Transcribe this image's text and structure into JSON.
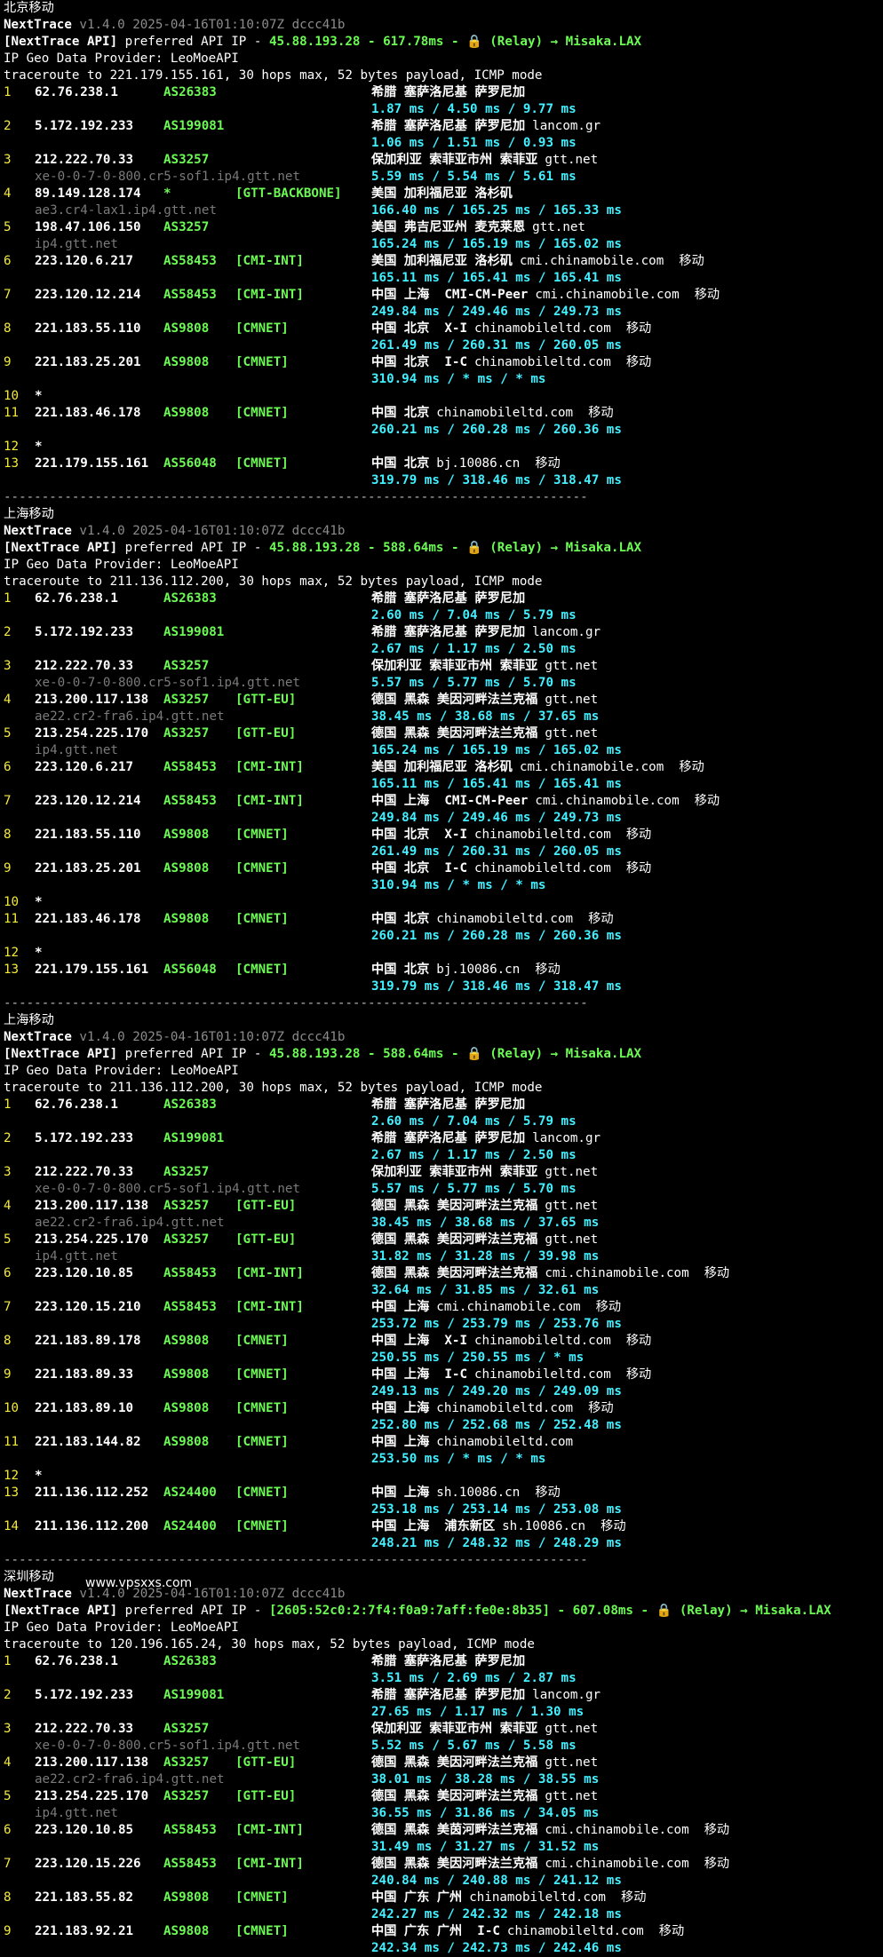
{
  "watermark": "www.vpsxxs.com",
  "sections": [
    {
      "loc": "北京移动",
      "ver_name": "NextTrace",
      "ver": "v1.4.0 2025-04-16T01:10:07Z dccc41b",
      "api_prefix": "[NextTrace API]",
      "api_text": " preferred API IP - ",
      "api_ip": "45.88.193.28",
      "api_dash": " - ",
      "api_ms": "617.78ms",
      "api_relay": " - 🔒 (Relay) → Misaka.LAX",
      "geo_provider": "IP Geo Data Provider: LeoMoeAPI",
      "trace": "traceroute to 221.179.155.161, 30 hops max, 52 bytes payload, ICMP mode",
      "hops": [
        {
          "n": "1",
          "ip": "62.76.238.1",
          "as": "AS26383",
          "tag": "",
          "geo": "希腊 塞萨洛尼基 萨罗尼加",
          "isp": "",
          "dom": "",
          "rtt": "1.87 ms / 4.50 ms / 9.77 ms"
        },
        {
          "n": "2",
          "ip": "5.172.192.233",
          "as": "AS199081",
          "tag": "",
          "geo": "希腊 塞萨洛尼基 萨罗尼加",
          "isp": "lancom.gr",
          "dom": "",
          "rtt": "1.06 ms / 1.51 ms / 0.93 ms"
        },
        {
          "n": "3",
          "ip": "212.222.70.33",
          "as": "AS3257",
          "tag": "",
          "geo": "保加利亚 索菲亚市州 索菲亚",
          "isp": "gtt.net",
          "dom": "xe-0-0-7-0-800.cr5-sof1.ip4.gtt.net",
          "rtt": "5.59 ms / 5.54 ms / 5.61 ms"
        },
        {
          "n": "4",
          "ip": "89.149.128.174",
          "as": "*",
          "tag": "[GTT-BACKBONE]",
          "geo": "美国 加利福尼亚 洛杉矶",
          "isp": "",
          "dom": "ae3.cr4-lax1.ip4.gtt.net",
          "rtt": "166.40 ms / 165.25 ms / 165.33 ms"
        },
        {
          "n": "5",
          "ip": "198.47.106.150",
          "as": "AS3257",
          "tag": "",
          "geo": "美国 弗吉尼亚州 麦克莱恩",
          "isp": "gtt.net",
          "dom": "ip4.gtt.net",
          "rtt": "165.24 ms / 165.19 ms / 165.02 ms"
        },
        {
          "n": "6",
          "ip": "223.120.6.217",
          "as": "AS58453",
          "tag": "[CMI-INT]",
          "geo": "美国 加利福尼亚 洛杉矶",
          "isp": "cmi.chinamobile.com  移动",
          "dom": "",
          "rtt": "165.11 ms / 165.41 ms / 165.41 ms"
        },
        {
          "n": "7",
          "ip": "223.120.12.214",
          "as": "AS58453",
          "tag": "[CMI-INT]",
          "geo": "中国 上海  CMI-CM-Peer",
          "isp": "cmi.chinamobile.com  移动",
          "dom": "",
          "rtt": "249.84 ms / 249.46 ms / 249.73 ms"
        },
        {
          "n": "8",
          "ip": "221.183.55.110",
          "as": "AS9808",
          "tag": "[CMNET]",
          "geo": "中国 北京  X-I",
          "isp": "chinamobileltd.com  移动",
          "dom": "",
          "rtt": "261.49 ms / 260.31 ms / 260.05 ms"
        },
        {
          "n": "9",
          "ip": "221.183.25.201",
          "as": "AS9808",
          "tag": "[CMNET]",
          "geo": "中国 北京  I-C",
          "isp": "chinamobileltd.com  移动",
          "dom": "",
          "rtt": "310.94 ms / * ms / * ms"
        },
        {
          "n": "10",
          "ip": "*",
          "as": "",
          "tag": "",
          "geo": "",
          "isp": "",
          "dom": "",
          "rtt": ""
        },
        {
          "n": "11",
          "ip": "221.183.46.178",
          "as": "AS9808",
          "tag": "[CMNET]",
          "geo": "中国 北京",
          "isp": "chinamobileltd.com  移动",
          "dom": "",
          "rtt": "260.21 ms / 260.28 ms / 260.36 ms"
        },
        {
          "n": "12",
          "ip": "*",
          "as": "",
          "tag": "",
          "geo": "",
          "isp": "",
          "dom": "",
          "rtt": ""
        },
        {
          "n": "13",
          "ip": "221.179.155.161",
          "as": "AS56048",
          "tag": "[CMNET]",
          "geo": "中国 北京",
          "isp": "bj.10086.cn  移动",
          "dom": "",
          "rtt": "319.79 ms / 318.46 ms / 318.47 ms"
        }
      ]
    },
    {
      "loc": "上海移动",
      "ver_name": "NextTrace",
      "ver": "v1.4.0 2025-04-16T01:10:07Z dccc41b",
      "api_prefix": "[NextTrace API]",
      "api_text": " preferred API IP - ",
      "api_ip": "45.88.193.28",
      "api_dash": " - ",
      "api_ms": "588.64ms",
      "api_relay": " - 🔒 (Relay) → Misaka.LAX",
      "geo_provider": "IP Geo Data Provider: LeoMoeAPI",
      "trace": "traceroute to 211.136.112.200, 30 hops max, 52 bytes payload, ICMP mode",
      "hops": [
        {
          "n": "1",
          "ip": "62.76.238.1",
          "as": "AS26383",
          "tag": "",
          "geo": "希腊 塞萨洛尼基 萨罗尼加",
          "isp": "",
          "dom": "",
          "rtt": "2.60 ms / 7.04 ms / 5.79 ms"
        },
        {
          "n": "2",
          "ip": "5.172.192.233",
          "as": "AS199081",
          "tag": "",
          "geo": "希腊 塞萨洛尼基 萨罗尼加",
          "isp": "lancom.gr",
          "dom": "",
          "rtt": "2.67 ms / 1.17 ms / 2.50 ms"
        },
        {
          "n": "3",
          "ip": "212.222.70.33",
          "as": "AS3257",
          "tag": "",
          "geo": "保加利亚 索菲亚市州 索菲亚",
          "isp": "gtt.net",
          "dom": "xe-0-0-7-0-800.cr5-sof1.ip4.gtt.net",
          "rtt": "5.57 ms / 5.77 ms / 5.70 ms"
        },
        {
          "n": "4",
          "ip": "213.200.117.138",
          "as": "AS3257",
          "tag": "[GTT-EU]",
          "geo": "德国 黑森 美因河畔法兰克福",
          "isp": "gtt.net",
          "dom": "ae22.cr2-fra6.ip4.gtt.net",
          "rtt": "38.45 ms / 38.68 ms / 37.65 ms"
        },
        {
          "n": "5",
          "ip": "213.254.225.170",
          "as": "AS3257",
          "tag": "[GTT-EU]",
          "geo": "德国 黑森 美因河畔法兰克福",
          "isp": "gtt.net",
          "dom": "ip4.gtt.net",
          "rtt": "165.24 ms / 165.19 ms / 165.02 ms"
        },
        {
          "n": "6",
          "ip": "223.120.6.217",
          "as": "AS58453",
          "tag": "[CMI-INT]",
          "geo": "美国 加利福尼亚 洛杉矶",
          "isp": "cmi.chinamobile.com  移动",
          "dom": "",
          "rtt": "165.11 ms / 165.41 ms / 165.41 ms"
        },
        {
          "n": "7",
          "ip": "223.120.12.214",
          "as": "AS58453",
          "tag": "[CMI-INT]",
          "geo": "中国 上海  CMI-CM-Peer",
          "isp": "cmi.chinamobile.com  移动",
          "dom": "",
          "rtt": "249.84 ms / 249.46 ms / 249.73 ms"
        },
        {
          "n": "8",
          "ip": "221.183.55.110",
          "as": "AS9808",
          "tag": "[CMNET]",
          "geo": "中国 北京  X-I",
          "isp": "chinamobileltd.com  移动",
          "dom": "",
          "rtt": "261.49 ms / 260.31 ms / 260.05 ms"
        },
        {
          "n": "9",
          "ip": "221.183.25.201",
          "as": "AS9808",
          "tag": "[CMNET]",
          "geo": "中国 北京  I-C",
          "isp": "chinamobileltd.com  移动",
          "dom": "",
          "rtt": "310.94 ms / * ms / * ms"
        },
        {
          "n": "10",
          "ip": "*",
          "as": "",
          "tag": "",
          "geo": "",
          "isp": "",
          "dom": "",
          "rtt": ""
        },
        {
          "n": "11",
          "ip": "221.183.46.178",
          "as": "AS9808",
          "tag": "[CMNET]",
          "geo": "中国 北京",
          "isp": "chinamobileltd.com  移动",
          "dom": "",
          "rtt": "260.21 ms / 260.28 ms / 260.36 ms"
        },
        {
          "n": "12",
          "ip": "*",
          "as": "",
          "tag": "",
          "geo": "",
          "isp": "",
          "dom": "",
          "rtt": ""
        },
        {
          "n": "13",
          "ip": "221.179.155.161",
          "as": "AS56048",
          "tag": "[CMNET]",
          "geo": "中国 北京",
          "isp": "bj.10086.cn  移动",
          "dom": "",
          "rtt": "319.79 ms / 318.46 ms / 318.47 ms"
        }
      ]
    },
    {
      "loc": "上海移动",
      "ver_name": "NextTrace",
      "ver": "v1.4.0 2025-04-16T01:10:07Z dccc41b",
      "api_prefix": "[NextTrace API]",
      "api_text": " preferred API IP - ",
      "api_ip": "45.88.193.28",
      "api_dash": " - ",
      "api_ms": "588.64ms",
      "api_relay": " - 🔒 (Relay) → Misaka.LAX",
      "geo_provider": "IP Geo Data Provider: LeoMoeAPI",
      "trace": "traceroute to 211.136.112.200, 30 hops max, 52 bytes payload, ICMP mode",
      "hops": [
        {
          "n": "1",
          "ip": "62.76.238.1",
          "as": "AS26383",
          "tag": "",
          "geo": "希腊 塞萨洛尼基 萨罗尼加",
          "isp": "",
          "dom": "",
          "rtt": "2.60 ms / 7.04 ms / 5.79 ms"
        },
        {
          "n": "2",
          "ip": "5.172.192.233",
          "as": "AS199081",
          "tag": "",
          "geo": "希腊 塞萨洛尼基 萨罗尼加",
          "isp": "lancom.gr",
          "dom": "",
          "rtt": "2.67 ms / 1.17 ms / 2.50 ms"
        },
        {
          "n": "3",
          "ip": "212.222.70.33",
          "as": "AS3257",
          "tag": "",
          "geo": "保加利亚 索菲亚市州 索菲亚",
          "isp": "gtt.net",
          "dom": "xe-0-0-7-0-800.cr5-sof1.ip4.gtt.net",
          "rtt": "5.57 ms / 5.77 ms / 5.70 ms"
        },
        {
          "n": "4",
          "ip": "213.200.117.138",
          "as": "AS3257",
          "tag": "[GTT-EU]",
          "geo": "德国 黑森 美因河畔法兰克福",
          "isp": "gtt.net",
          "dom": "ae22.cr2-fra6.ip4.gtt.net",
          "rtt": "38.45 ms / 38.68 ms / 37.65 ms"
        },
        {
          "n": "5",
          "ip": "213.254.225.170",
          "as": "AS3257",
          "tag": "[GTT-EU]",
          "geo": "德国 黑森 美因河畔法兰克福",
          "isp": "gtt.net",
          "dom": "ip4.gtt.net",
          "rtt": "31.82 ms / 31.28 ms / 39.98 ms"
        },
        {
          "n": "6",
          "ip": "223.120.10.85",
          "as": "AS58453",
          "tag": "[CMI-INT]",
          "geo": "德国 黑森 美因河畔法兰克福",
          "isp": "cmi.chinamobile.com  移动",
          "dom": "",
          "rtt": "32.64 ms / 31.85 ms / 32.61 ms"
        },
        {
          "n": "7",
          "ip": "223.120.15.210",
          "as": "AS58453",
          "tag": "[CMI-INT]",
          "geo": "中国 上海",
          "isp": "cmi.chinamobile.com  移动",
          "dom": "",
          "rtt": "253.72 ms / 253.79 ms / 253.76 ms"
        },
        {
          "n": "8",
          "ip": "221.183.89.178",
          "as": "AS9808",
          "tag": "[CMNET]",
          "geo": "中国 上海  X-I",
          "isp": "chinamobileltd.com  移动",
          "dom": "",
          "rtt": "250.55 ms / 250.55 ms / * ms"
        },
        {
          "n": "9",
          "ip": "221.183.89.33",
          "as": "AS9808",
          "tag": "[CMNET]",
          "geo": "中国 上海  I-C",
          "isp": "chinamobileltd.com  移动",
          "dom": "",
          "rtt": "249.13 ms / 249.20 ms / 249.09 ms"
        },
        {
          "n": "10",
          "ip": "221.183.89.10",
          "as": "AS9808",
          "tag": "[CMNET]",
          "geo": "中国 上海",
          "isp": "chinamobileltd.com  移动",
          "dom": "",
          "rtt": "252.80 ms / 252.68 ms / 252.48 ms"
        },
        {
          "n": "11",
          "ip": "221.183.144.82",
          "as": "AS9808",
          "tag": "[CMNET]",
          "geo": "中国 上海",
          "isp": "chinamobileltd.com",
          "dom": "",
          "rtt": "253.50 ms / * ms / * ms"
        },
        {
          "n": "12",
          "ip": "*",
          "as": "",
          "tag": "",
          "geo": "",
          "isp": "",
          "dom": "",
          "rtt": ""
        },
        {
          "n": "13",
          "ip": "211.136.112.252",
          "as": "AS24400",
          "tag": "[CMNET]",
          "geo": "中国 上海",
          "isp": "sh.10086.cn  移动",
          "dom": "",
          "rtt": "253.18 ms / 253.14 ms / 253.08 ms"
        },
        {
          "n": "14",
          "ip": "211.136.112.200",
          "as": "AS24400",
          "tag": "[CMNET]",
          "geo": "中国 上海  浦东新区",
          "isp": "sh.10086.cn  移动",
          "dom": "",
          "rtt": "248.21 ms / 248.32 ms / 248.29 ms"
        }
      ]
    },
    {
      "loc": "深圳移动",
      "ver_name": "NextTrace",
      "ver": "v1.4.0 2025-04-16T01:10:07Z dccc41b",
      "api_prefix": "[NextTrace API]",
      "api_text": " preferred API IP - ",
      "api_ip": "[2605:52c0:2:7f4:f0a9:7aff:fe0e:8b35]",
      "api_dash": " - ",
      "api_ms": "607.08ms",
      "api_relay": " - 🔒 (Relay) → Misaka.LAX",
      "geo_provider": "IP Geo Data Provider: LeoMoeAPI",
      "trace": "traceroute to 120.196.165.24, 30 hops max, 52 bytes payload, ICMP mode",
      "hops": [
        {
          "n": "1",
          "ip": "62.76.238.1",
          "as": "AS26383",
          "tag": "",
          "geo": "希腊 塞萨洛尼基 萨罗尼加",
          "isp": "",
          "dom": "",
          "rtt": "3.51 ms / 2.69 ms / 2.87 ms"
        },
        {
          "n": "2",
          "ip": "5.172.192.233",
          "as": "AS199081",
          "tag": "",
          "geo": "希腊 塞萨洛尼基 萨罗尼加",
          "isp": "lancom.gr",
          "dom": "",
          "rtt": "27.65 ms / 1.17 ms / 1.30 ms"
        },
        {
          "n": "3",
          "ip": "212.222.70.33",
          "as": "AS3257",
          "tag": "",
          "geo": "保加利亚 索菲亚市州 索菲亚",
          "isp": "gtt.net",
          "dom": "xe-0-0-7-0-800.cr5-sof1.ip4.gtt.net",
          "rtt": "5.52 ms / 5.67 ms / 5.58 ms"
        },
        {
          "n": "4",
          "ip": "213.200.117.138",
          "as": "AS3257",
          "tag": "[GTT-EU]",
          "geo": "德国 黑森 美因河畔法兰克福",
          "isp": "gtt.net",
          "dom": "ae22.cr2-fra6.ip4.gtt.net",
          "rtt": "38.01 ms / 38.28 ms / 38.55 ms"
        },
        {
          "n": "5",
          "ip": "213.254.225.170",
          "as": "AS3257",
          "tag": "[GTT-EU]",
          "geo": "德国 黑森 美因河畔法兰克福",
          "isp": "gtt.net",
          "dom": "ip4.gtt.net",
          "rtt": "36.55 ms / 31.86 ms / 34.05 ms"
        },
        {
          "n": "6",
          "ip": "223.120.10.85",
          "as": "AS58453",
          "tag": "[CMI-INT]",
          "geo": "德国 黑森 美茵河畔法兰克福",
          "isp": "cmi.chinamobile.com  移动",
          "dom": "",
          "rtt": "31.49 ms / 31.27 ms / 31.52 ms"
        },
        {
          "n": "7",
          "ip": "223.120.15.226",
          "as": "AS58453",
          "tag": "[CMI-INT]",
          "geo": "德国 黑森 美因河畔法兰克福",
          "isp": "cmi.chinamobile.com  移动",
          "dom": "",
          "rtt": "240.84 ms / 240.88 ms / 241.12 ms"
        },
        {
          "n": "8",
          "ip": "221.183.55.82",
          "as": "AS9808",
          "tag": "[CMNET]",
          "geo": "中国 广东 广州",
          "isp": "chinamobileltd.com  移动",
          "dom": "",
          "rtt": "242.27 ms / 242.32 ms / 242.18 ms"
        },
        {
          "n": "9",
          "ip": "221.183.92.21",
          "as": "AS9808",
          "tag": "[CMNET]",
          "geo": "中国 广东 广州  I-C",
          "isp": "chinamobileltd.com  移动",
          "dom": "",
          "rtt": "242.34 ms / 242.73 ms / 242.46 ms"
        }
      ]
    }
  ],
  "separator": "-----------------------------------------------------------------------------"
}
